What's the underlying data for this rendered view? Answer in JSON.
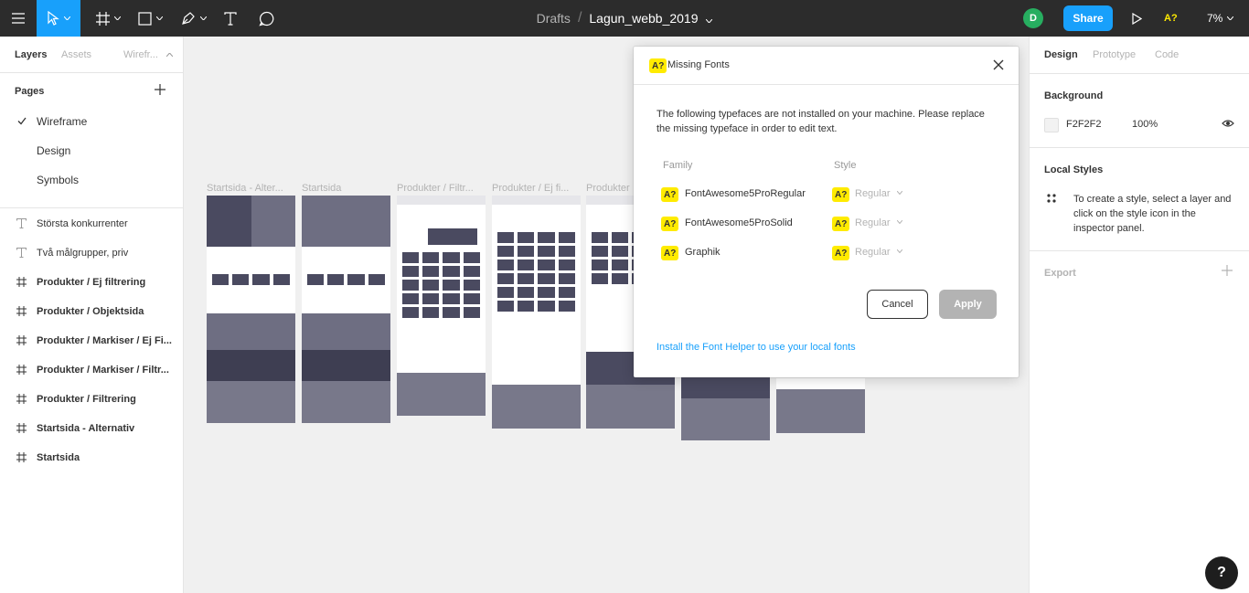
{
  "toolbar": {
    "drafts_label": "Drafts",
    "file_name": "Lagun_webb_2019",
    "avatar_initial": "D",
    "share_label": "Share",
    "font_warning_label": "A?",
    "zoom_label": "7%",
    "tools": [
      "menu-icon",
      "move-icon",
      "frame-icon",
      "shape-icon",
      "pen-icon",
      "text-icon",
      "comment-icon"
    ]
  },
  "left_panel": {
    "tabs": [
      "Layers",
      "Assets",
      "Wirefr..."
    ],
    "pages_title": "Pages",
    "pages": [
      {
        "label": "Wireframe",
        "selected": true
      },
      {
        "label": "Design",
        "selected": false
      },
      {
        "label": "Symbols",
        "selected": false
      }
    ],
    "layers": [
      {
        "label": "Största konkurrenter",
        "type": "text"
      },
      {
        "label": "Två målgrupper, priv",
        "type": "text"
      },
      {
        "label": "Produkter / Ej filtrering",
        "type": "frame"
      },
      {
        "label": "Produkter / Objektsida",
        "type": "frame"
      },
      {
        "label": "Produkter / Markiser / Ej Fi...",
        "type": "frame"
      },
      {
        "label": "Produkter / Markiser / Filtr...",
        "type": "frame"
      },
      {
        "label": "Produkter / Filtrering",
        "type": "frame"
      },
      {
        "label": "Startsida - Alternativ",
        "type": "frame"
      },
      {
        "label": "Startsida",
        "type": "frame"
      }
    ]
  },
  "right_panel": {
    "tabs": [
      "Design",
      "Prototype",
      "Code"
    ],
    "background_title": "Background",
    "background_hex": "F2F2F2",
    "background_opacity": "100%",
    "local_styles_title": "Local Styles",
    "local_styles_hint": "To create a style, select a layer and click on the style icon in the inspector panel.",
    "export_title": "Export"
  },
  "canvas": {
    "frame_labels": [
      "Startsida - Alter...",
      "Startsida",
      "Produkter / Filtr...",
      "Produkter / Ej fi...",
      "Produkter"
    ]
  },
  "dialog": {
    "badge": "A?",
    "title": "Missing Fonts",
    "description": "The following typefaces are not installed on your machine. Please replace the missing typeface in order to edit text.",
    "family_header": "Family",
    "style_header": "Style",
    "fonts": [
      {
        "family": "FontAwesome5ProRegular",
        "style": "Regular"
      },
      {
        "family": "FontAwesome5ProSolid",
        "style": "Regular"
      },
      {
        "family": "Graphik",
        "style": "Regular"
      }
    ],
    "cancel_label": "Cancel",
    "apply_label": "Apply",
    "helper_link": "Install the Font Helper to use your local fonts"
  },
  "help_label": "?",
  "colors": {
    "accent": "#18a0fb",
    "warning": "#ffeb00",
    "toolbar_bg": "#2c2c2c",
    "canvas_bg": "#f0f0f0"
  }
}
